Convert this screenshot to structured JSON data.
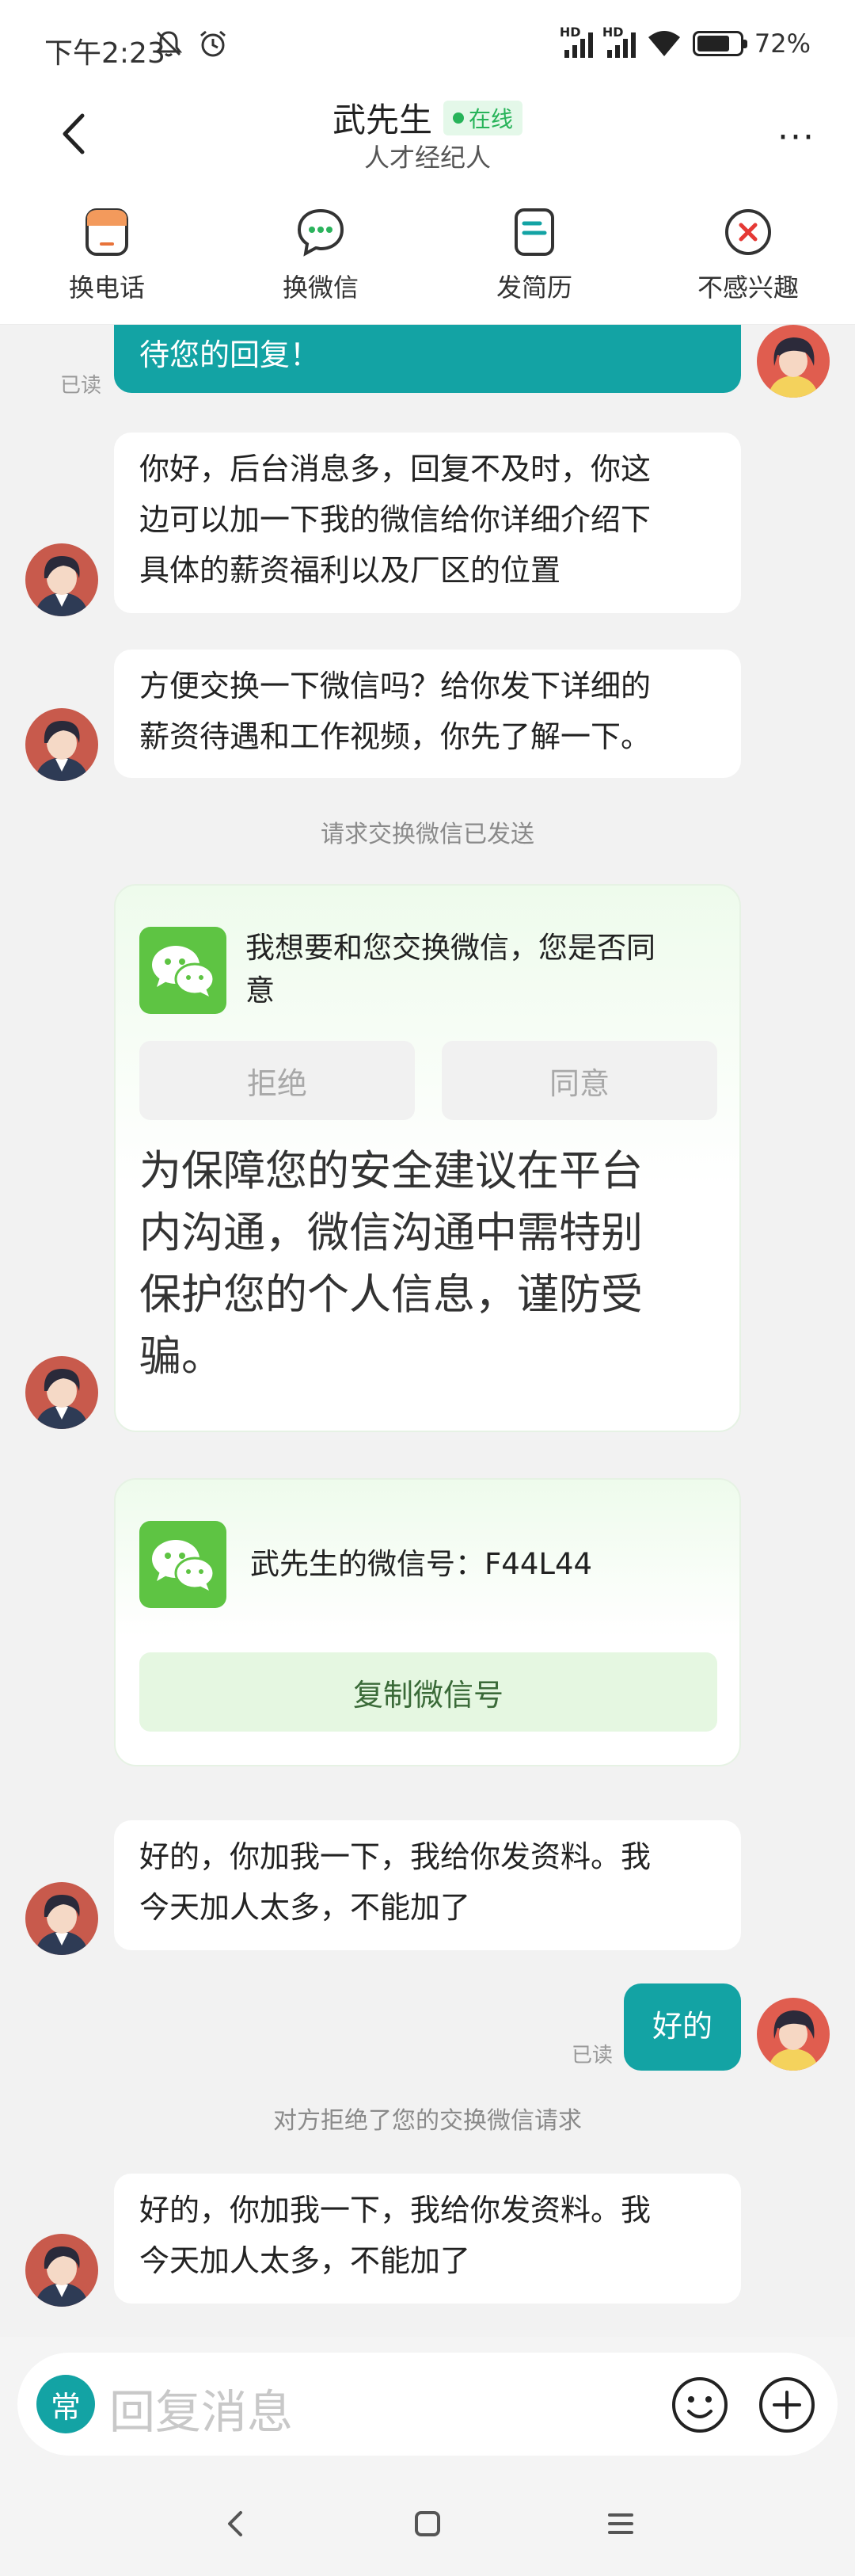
{
  "status_bar": {
    "time": "下午2:23",
    "network_1": "HD",
    "network_2": "HD",
    "battery_percent": "72%",
    "icons": [
      "mute-icon",
      "alarm-icon",
      "signal-icon",
      "wifi-icon",
      "battery-icon"
    ]
  },
  "header": {
    "name": "武先生",
    "status": "在线",
    "role": "人才经纪人",
    "more": "···"
  },
  "actions": [
    {
      "label": "换电话",
      "icon": "phone-card-icon",
      "color": "#e8733a"
    },
    {
      "label": "换微信",
      "icon": "wechat-chat-icon",
      "color": "#2bb35c"
    },
    {
      "label": "发简历",
      "icon": "resume-icon",
      "color": "#13a3a4"
    },
    {
      "label": "不感兴趣",
      "icon": "not-interested-icon",
      "color": "#e53935"
    }
  ],
  "messages": {
    "m0_text": "待您的回复！",
    "m0_read": "已读",
    "m1_lines": [
      "你好，后台消息多，回复不及时，你这",
      "边可以加一下我的微信给你详细介绍下",
      "具体的薪资福利以及厂区的位置"
    ],
    "m2_lines": [
      "方便交换一下微信吗？给你发下详细的",
      "薪资待遇和工作视频，你先了解一下。"
    ],
    "sys1": "请求交换微信已发送",
    "card1": {
      "question_lines": [
        "我想要和您交换微信，您是否同",
        "意"
      ],
      "reject": "拒绝",
      "agree": "同意",
      "warning_lines": [
        "为保障您的安全建议在平台",
        "内沟通，微信沟通中需特别",
        "保护您的个人信息，谨防受",
        "骗。"
      ]
    },
    "card2": {
      "wechat_id_text": "武先生的微信号：F44L44",
      "copy": "复制微信号"
    },
    "m3_lines": [
      "好的，你加我一下，我给你发资料。我",
      "今天加人太多，不能加了"
    ],
    "m4_text": "好的",
    "m4_read": "已读",
    "sys2": "对方拒绝了您的交换微信请求",
    "m5_lines": [
      "好的，你加我一下，我给你发资料。我",
      "今天加人太多，不能加了"
    ]
  },
  "input": {
    "common_label": "常",
    "placeholder": "回复消息"
  },
  "colors": {
    "accent": "#13a3a4",
    "online_green": "#27b359",
    "wechat_green": "#5ec443"
  }
}
